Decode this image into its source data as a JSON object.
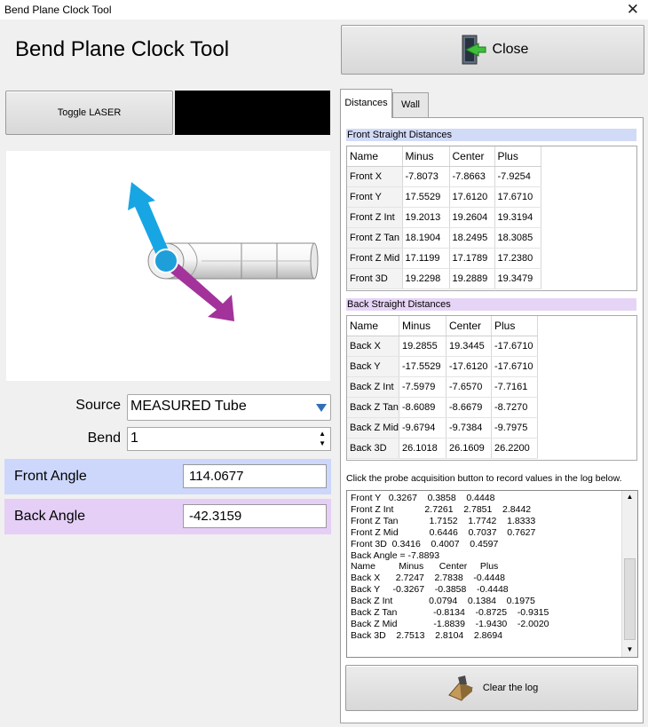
{
  "window": {
    "title": "Bend Plane Clock Tool",
    "close_glyph": "✕"
  },
  "header": {
    "title": "Bend Plane Clock Tool"
  },
  "buttons": {
    "close_label": "Close",
    "toggle_laser_label": "Toggle LASER",
    "clear_log_label": "Clear the log"
  },
  "form": {
    "source_label": "Source",
    "source_value": "MEASURED Tube",
    "bend_label": "Bend",
    "bend_value": "1",
    "front_angle_label": "Front Angle",
    "front_angle_value": "114.0677",
    "back_angle_label": "Back Angle",
    "back_angle_value": "-42.3159"
  },
  "colors": {
    "front_angle_bg": "#ccd7fb",
    "back_angle_bg": "#e5cff6",
    "front_hdr": "#d1daf7",
    "back_hdr": "#e6d4f6",
    "arrow_blue": "#17a6e3",
    "arrow_purple": "#a3339b"
  },
  "tabs": [
    "Distances",
    "Wall"
  ],
  "front": {
    "title": "Front Straight Distances",
    "columns": [
      "Name",
      "Minus",
      "Center",
      "Plus"
    ],
    "rows": [
      [
        "Front X",
        "-7.8073",
        "-7.8663",
        "-7.9254"
      ],
      [
        "Front Y",
        "17.5529",
        "17.6120",
        "17.6710"
      ],
      [
        "Front Z Int",
        "19.2013",
        "19.2604",
        "19.3194"
      ],
      [
        "Front Z Tan",
        "18.1904",
        "18.2495",
        "18.3085"
      ],
      [
        "Front Z Mid",
        "17.1199",
        "17.1789",
        "17.2380"
      ],
      [
        "Front 3D",
        "19.2298",
        "19.2889",
        "19.3479"
      ]
    ]
  },
  "back": {
    "title": "Back Straight Distances",
    "columns": [
      "Name",
      "Minus",
      "Center",
      "Plus"
    ],
    "rows": [
      [
        "Back X",
        "19.2855",
        "19.3445",
        "-17.6710"
      ],
      [
        "Back Y",
        "-17.5529",
        "-17.6120",
        "-17.6710"
      ],
      [
        "Back Z Int",
        "-7.5979",
        "-7.6570",
        "-7.7161"
      ],
      [
        "Back Z Tan",
        "-8.6089",
        "-8.6679",
        "-8.7270"
      ],
      [
        "Back Z Mid",
        "-9.6794",
        "-9.7384",
        "-9.7975"
      ],
      [
        "Back 3D",
        "26.1018",
        "26.1609",
        "26.2200"
      ]
    ]
  },
  "log": {
    "instruction": "Click the probe acquisition button to record values in the log below.",
    "lines": [
      "Front Y   0.3267    0.3858    0.4448",
      "Front Z Int            2.7261    2.7851    2.8442",
      "Front Z Tan            1.7152    1.7742    1.8333",
      "Front Z Mid            0.6446    0.7037    0.7627",
      "Front 3D  0.3416    0.4007    0.4597",
      "Back Angle = -7.8893",
      "Name         Minus      Center     Plus",
      "Back X      2.7247    2.7838    -0.4448",
      "Back Y     -0.3267    -0.3858    -0.4448",
      "Back Z Int              0.0794    0.1384    0.1975",
      "Back Z Tan              -0.8134    -0.8725    -0.9315",
      "Back Z Mid              -1.8839    -1.9430    -2.0020",
      "Back 3D    2.7513    2.8104    2.8694"
    ]
  }
}
